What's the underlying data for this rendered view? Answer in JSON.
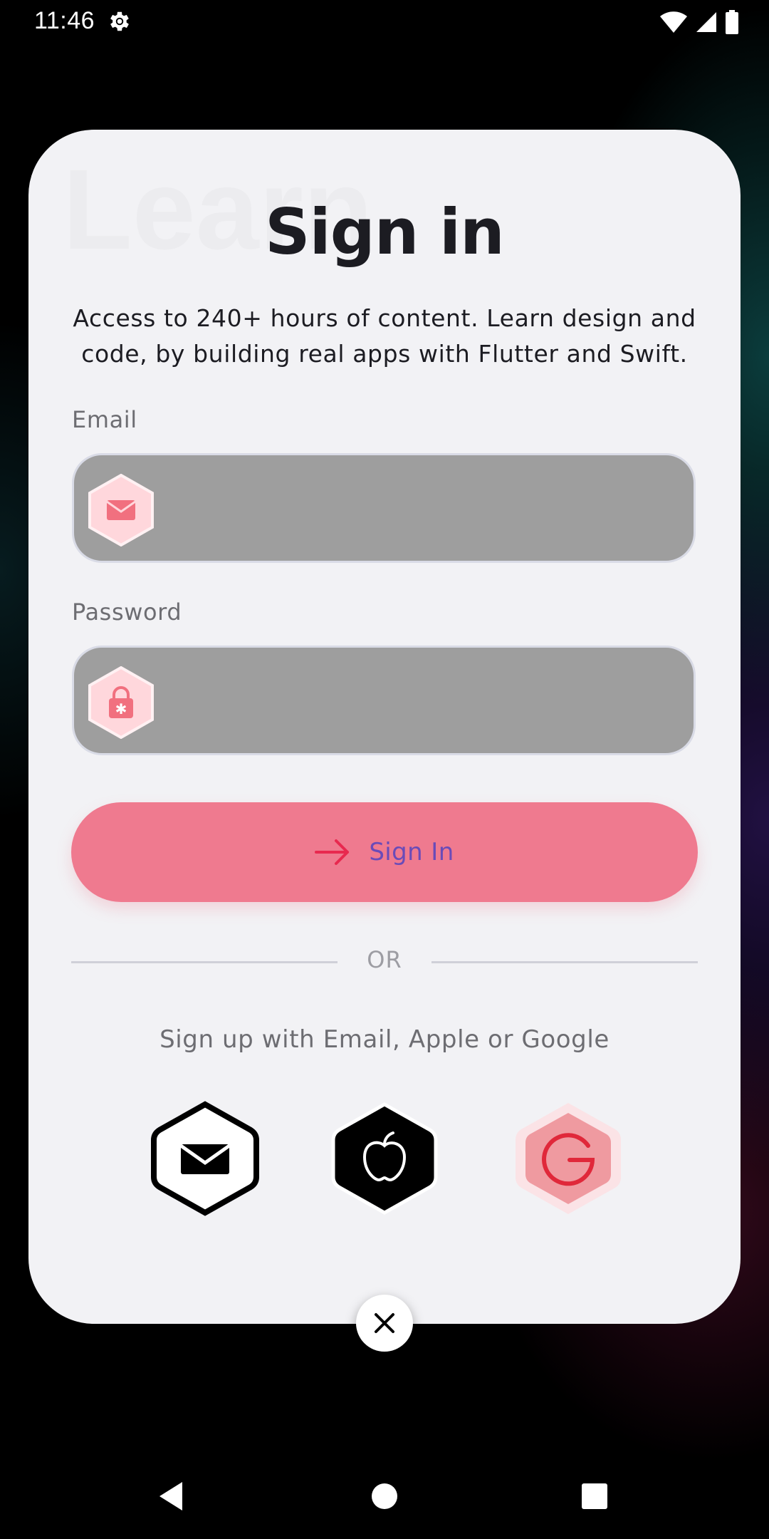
{
  "status_bar": {
    "time": "11:46",
    "icons": [
      "gear-icon",
      "wifi-icon",
      "signal-icon",
      "battery-icon"
    ]
  },
  "card": {
    "ghost_text": "Learn",
    "title": "Sign in",
    "subtitle": "Access to 240+ hours of content. Learn design and code, by building real apps with Flutter and Swift.",
    "email": {
      "label": "Email",
      "value": "",
      "placeholder": "",
      "icon": "mail-icon"
    },
    "password": {
      "label": "Password",
      "value": "",
      "placeholder": "",
      "icon": "lock-icon"
    },
    "signin_button": {
      "label": "Sign In",
      "icon": "arrow-right-icon"
    },
    "or_text": "OR",
    "signup_text": "Sign up with Email, Apple or Google",
    "social": [
      {
        "name": "email",
        "icon": "mail-icon"
      },
      {
        "name": "apple",
        "icon": "apple-icon"
      },
      {
        "name": "google",
        "icon": "google-icon"
      }
    ],
    "close_icon": "close-icon"
  },
  "colors": {
    "accent": "#ef7a8f",
    "button_text": "#6a4bb8",
    "arrow": "#e8294f",
    "card_bg": "#f2f2f5",
    "field_bg": "#9e9e9e"
  },
  "nav_bar": {
    "buttons": [
      "back-icon",
      "home-icon",
      "recents-icon"
    ]
  }
}
